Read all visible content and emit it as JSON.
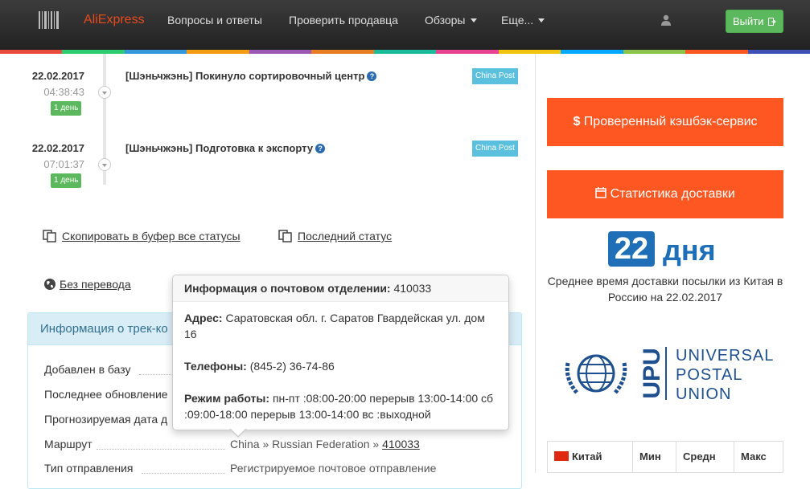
{
  "navbar": {
    "brand": "AliExpress",
    "items": [
      "Вопросы и ответы",
      "Проверить продавца",
      "Обзоры",
      "Еще..."
    ],
    "logout_label": "Выйти"
  },
  "stripe_colors": [
    "#e74c3c",
    "#2ecc71",
    "#3498db",
    "#f39c12",
    "#9b59b6",
    "#e67e22",
    "#1abc9c",
    "#e84393",
    "#f1c40f",
    "#00a8ff",
    "#8bc34a",
    "#ff5722",
    "#3f51b5"
  ],
  "timeline": [
    {
      "date": "22.02.2017",
      "time": "04:38:43",
      "days": "1 день",
      "status": "[Шэньчжэнь] Покинуло сортировочный центр",
      "carrier": "China Post"
    },
    {
      "date": "22.02.2017",
      "time": "07:01:37",
      "days": "1 день",
      "status": "[Шэньчжэнь] Подготовка к экспорту",
      "carrier": "China Post"
    }
  ],
  "actions": {
    "copy_all": "Скопировать в буфер все статусы",
    "last_status": "Последний статус",
    "no_translation": "Без перевода"
  },
  "info_panel": {
    "heading": "Информация о трек-ко",
    "rows": [
      {
        "label": "Добавлен в базу",
        "value": ""
      },
      {
        "label": "Последнее обновление",
        "value": ""
      },
      {
        "label": "Прогнозируемая дата д",
        "value": ""
      },
      {
        "label": "Маршрут",
        "value_prefix": "China » Russian Federation » ",
        "value_link": "410033"
      },
      {
        "label": "Тип отправления",
        "value": "Регистрируемое почтовое отправление"
      }
    ]
  },
  "popover": {
    "title_label": "Информация о почтовом отделении:",
    "title_value": "410033",
    "address_label": "Адрес:",
    "address_value": "Саратовская обл. г. Саратов Гвардейская ул. дом 16",
    "phone_label": "Телефоны:",
    "phone_value": "(845-2) 36-74-86",
    "hours_label": "Режим работы:",
    "hours_value": "пн-пт :08:00-20:00 перерыв 13:00-14:00 сб :09:00-18:00 перерыв 13:00-14:00 вс :выходной"
  },
  "sidebar": {
    "cashback_label": "Проверенный кэшбэк-сервис",
    "stats_label": "Статистика доставки",
    "days_number": "22",
    "days_word": "дня",
    "avg_text": "Среднее время доставки посылки из Китая в Россию на 22.02.2017",
    "upu_logo_text": [
      "UPU",
      "UNIVERSAL",
      "POSTAL",
      "UNION"
    ],
    "table_headers": [
      "Китай",
      "Мин",
      "Средн",
      "Макс"
    ]
  }
}
